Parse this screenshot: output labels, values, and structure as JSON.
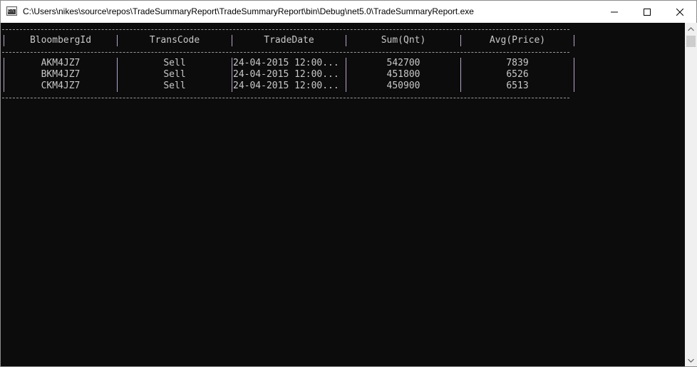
{
  "window": {
    "title": "C:\\Users\\nikes\\source\\repos\\TradeSummaryReport\\TradeSummaryReport\\bin\\Debug\\net5.0\\TradeSummaryReport.exe",
    "icon": "console-app-icon",
    "controls": [
      "minimize-icon",
      "maximize-icon",
      "close-icon"
    ]
  },
  "table": {
    "columns": [
      "BloombergId",
      "TransCode",
      "TradeDate",
      "Sum(Qnt)",
      "Avg(Price)"
    ],
    "rows": [
      [
        "AKM4JZ7",
        "Sell",
        "24-04-2015 12:00...",
        "542700",
        "7839"
      ],
      [
        "BKM4JZ7",
        "Sell",
        "24-04-2015 12:00...",
        "451800",
        "6526"
      ],
      [
        "CKM4JZ7",
        "Sell",
        "24-04-2015 12:00...",
        "450900",
        "6513"
      ]
    ]
  },
  "colors": {
    "console_bg": "#0c0c0c",
    "console_text": "#c0c0c0",
    "separator": "#b7a4c8"
  }
}
